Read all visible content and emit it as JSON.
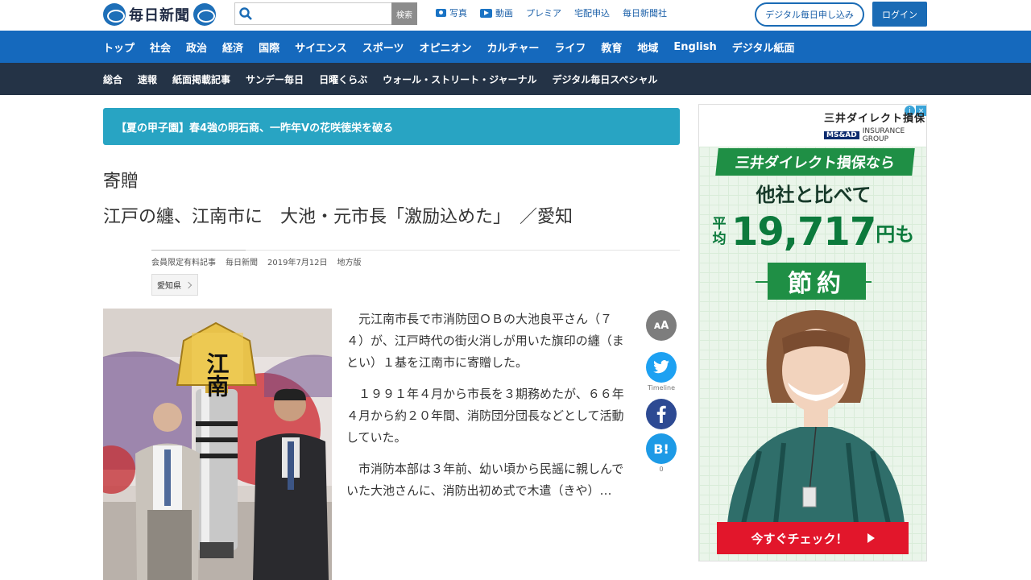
{
  "header": {
    "logo_text": "毎日新聞",
    "search_button": "検索",
    "search_placeholder": "",
    "top_links": [
      {
        "label": "写真",
        "icon": "camera-icon"
      },
      {
        "label": "動画",
        "icon": "play-icon"
      },
      {
        "label": "プレミア",
        "icon": ""
      },
      {
        "label": "宅配申込",
        "icon": ""
      },
      {
        "label": "毎日新聞社",
        "icon": ""
      }
    ],
    "subscribe_label": "デジタル毎日申し込み",
    "login_label": "ログイン"
  },
  "nav_primary": [
    "トップ",
    "社会",
    "政治",
    "経済",
    "国際",
    "サイエンス",
    "スポーツ",
    "オピニオン",
    "カルチャー",
    "ライフ",
    "教育",
    "地域",
    "English",
    "デジタル紙面"
  ],
  "nav_secondary": [
    "総合",
    "速報",
    "紙面掲載記事",
    "サンデー毎日",
    "日曜くらぶ",
    "ウォール・ストリート・ジャーナル",
    "デジタル毎日スペシャル"
  ],
  "banner": "【夏の甲子園】春4強の明石商、一昨年Vの花咲徳栄を破る",
  "article": {
    "kicker": "寄贈",
    "title": "江戸の纏、江南市に　大池・元市長「激励込めた」　／愛知",
    "meta": {
      "membership": "会員限定有料記事",
      "source": "毎日新聞",
      "date": "2019年7月12日",
      "section": "地方版"
    },
    "tag": "愛知県",
    "photo_sign_text": "江南",
    "paragraphs": [
      "元江南市長で市消防団ＯＢの大池良平さん（７４）が、江戸時代の街火消しが用いた旗印の纏（まとい）１基を江南市に寄贈した。",
      "１９９１年４月から市長を３期務めたが、６６年４月から約２０年間、消防団分団長などとして活動していた。",
      "市消防本部は３年前、幼い頃から民謡に親しんでいた大池さんに、消防出初め式で木遣（きや）…"
    ]
  },
  "share": {
    "font_size_label": "ᴀA",
    "twitter_caption": "Timeline",
    "hatena_label": "B!",
    "hatena_count": "0"
  },
  "ad": {
    "brand": "三井ダイレクト損保",
    "group_badge": "MS&AD",
    "group_text": "INSURANCE GROUP",
    "line1": "三井ダイレクト損保なら",
    "line2": "他社と比べて",
    "avg_label": "平均",
    "amount": "19,717",
    "amount_suffix": "円も",
    "save": "節約",
    "cta": "今すぐチェック！",
    "accent_green": "#1f8f45",
    "cta_red": "#e2162b"
  },
  "colors": {
    "nav_primary_bg": "#1569bd",
    "nav_secondary_bg": "#243346",
    "banner_bg": "#28a4c3"
  }
}
